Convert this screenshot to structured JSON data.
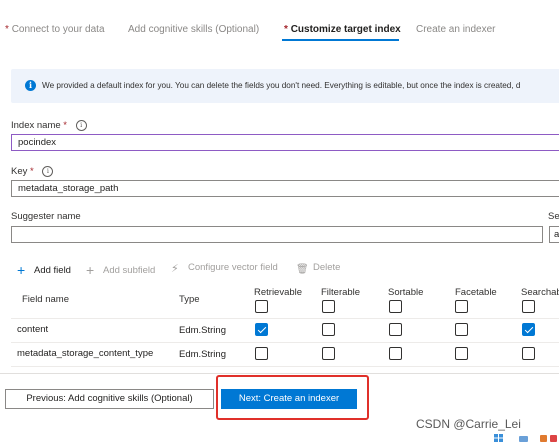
{
  "tabs": [
    {
      "label": "Connect to your data",
      "required": true
    },
    {
      "label": "Add cognitive skills (Optional)",
      "required": false
    },
    {
      "label": "Customize target index",
      "required": true
    },
    {
      "label": "Create an indexer",
      "required": false
    }
  ],
  "tab_required_marker": "*",
  "info": {
    "icon_glyph": "i",
    "text": "We provided a default index for you. You can delete the fields you don't need. Everything is editable, but once the index is created, d"
  },
  "form": {
    "index_name": {
      "label": "Index name",
      "required_marker": "*",
      "value": "pocindex"
    },
    "key": {
      "label": "Key",
      "required_marker": "*",
      "value": "metadata_storage_path"
    },
    "suggester_name": {
      "label": "Suggester name",
      "value": ""
    },
    "second_field": {
      "label": "Se",
      "value": "a"
    },
    "info_glyph": "i"
  },
  "toolbar": {
    "add_field": {
      "label": "Add field",
      "icon": "plus-icon",
      "glyph": "+"
    },
    "add_subfield": {
      "label": "Add subfield",
      "icon": "plus-icon",
      "glyph": "+"
    },
    "configure_vector": {
      "label": "Configure vector field",
      "icon": "lightning-icon",
      "glyph": "⚡"
    },
    "delete": {
      "label": "Delete",
      "icon": "trash-icon",
      "glyph": "🗑"
    }
  },
  "table": {
    "columns": [
      "Field name",
      "Type",
      "Retrievable",
      "Filterable",
      "Sortable",
      "Facetable",
      "Searchab"
    ],
    "rows": [
      {
        "name": "content",
        "type": "Edm.String",
        "retrievable": true,
        "filterable": false,
        "sortable": false,
        "facetable": false,
        "searchable": true
      },
      {
        "name": "metadata_storage_content_type",
        "type": "Edm.String",
        "retrievable": false,
        "filterable": false,
        "sortable": false,
        "facetable": false,
        "searchable": false
      }
    ]
  },
  "footer": {
    "prev_label": "Previous: Add cognitive skills (Optional)",
    "next_label": "Next: Create an indexer"
  },
  "watermark": "CSDN @Carrie_Lei",
  "colors": {
    "accent": "#0078d4",
    "highlight": "#e0302a",
    "required": "#a4262c",
    "info_bg": "#eef3fb"
  }
}
